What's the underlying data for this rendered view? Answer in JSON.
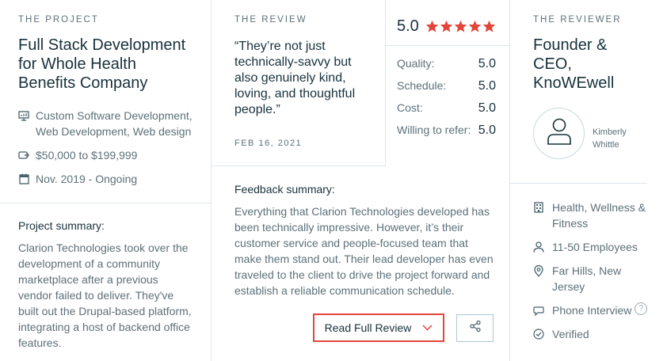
{
  "project": {
    "kicker": "THE PROJECT",
    "title_lines": [
      "Full Stack Development",
      "for Whole Health",
      "Benefits Company"
    ],
    "services_lines": [
      "Custom Software Development,",
      "Web Development, Web design"
    ],
    "budget": "$50,000 to $199,999",
    "timeline": "Nov. 2019 - Ongoing",
    "summary_label": "Project summary:",
    "summary_lines": [
      "Clarion Technologies took over the",
      "development of a community",
      "marketplace after a previous",
      "vendor failed to deliver. They've",
      "built out the Drupal-based platform,",
      "integrating a host of backend office",
      "features."
    ]
  },
  "review": {
    "kicker": "THE REVIEW",
    "quote_lines": [
      "“They’re not just",
      "technically-savvy but",
      "also genuinely kind,",
      "loving, and thoughtful",
      "people.”"
    ],
    "date": "FEB 16, 2021",
    "overall": "5.0",
    "star_count": 5,
    "star_color": "#e3453b",
    "ratings": [
      {
        "label": "Quality:",
        "value": "5.0"
      },
      {
        "label": "Schedule:",
        "value": "5.0"
      },
      {
        "label": "Cost:",
        "value": "5.0"
      },
      {
        "label": "Willing to refer:",
        "value": "5.0"
      }
    ],
    "feedback_label": "Feedback summary:",
    "feedback_lines": [
      "Everything that Clarion Technologies developed has",
      "been technically impressive. However, it’s their",
      "customer service and people-focused team that",
      "make them stand out. Their lead developer has even",
      "traveled to the client to drive the project forward and",
      "establish a reliable communication schedule."
    ],
    "read_full_label": "Read Full Review",
    "accent": "#e3453b"
  },
  "reviewer": {
    "kicker": "THE REVIEWER",
    "title_lines": [
      "Founder &",
      "CEO,",
      "KnoWEwell"
    ],
    "name_lines": [
      "Kimberly",
      "Whittle"
    ],
    "industry_lines": [
      "Health, Wellness &",
      "Fitness"
    ],
    "employees": "11-50 Employees",
    "location_lines": [
      "Far Hills, New",
      "Jersey"
    ],
    "interview": "Phone Interview",
    "help_glyph": "?",
    "verified": "Verified"
  },
  "icons": {
    "services": "monitor-icon",
    "budget": "tag-icon",
    "timeline": "calendar-icon",
    "share": "share-icon",
    "industry": "building-icon",
    "employees": "person-icon",
    "location": "map-pin-icon",
    "interview": "chat-bubble-icon",
    "verified": "check-circle-icon"
  }
}
